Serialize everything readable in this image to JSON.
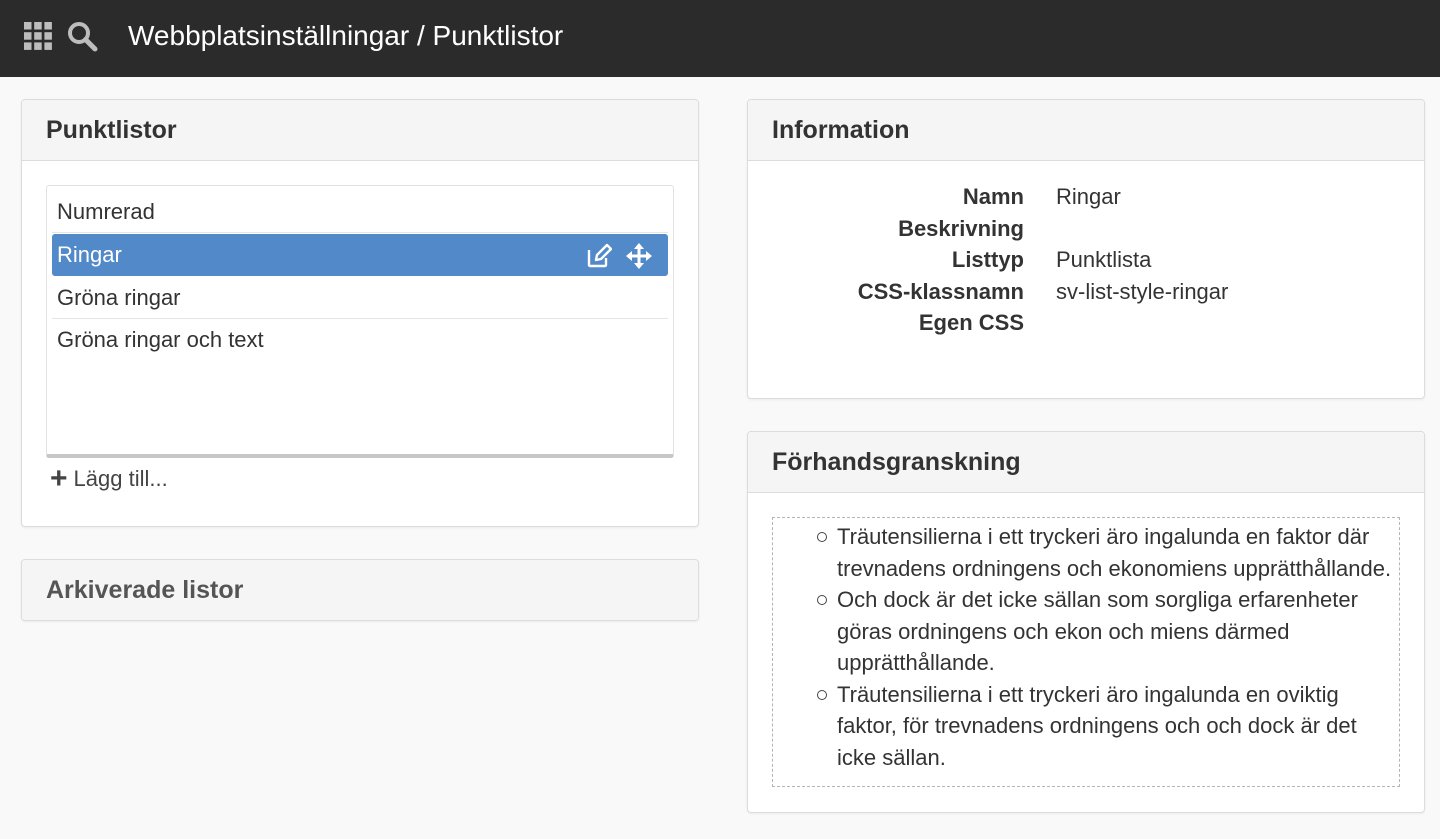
{
  "header": {
    "title": "Webbplatsinställningar / Punktlistor",
    "apps_icon": "grid-apps-icon",
    "search_icon": "search-icon"
  },
  "lists_panel": {
    "title": "Punktlistor",
    "items": [
      {
        "label": "Numrerad",
        "selected": false
      },
      {
        "label": "Ringar",
        "selected": true
      },
      {
        "label": "Gröna ringar",
        "selected": false
      },
      {
        "label": "Gröna ringar och text",
        "selected": false
      }
    ],
    "add_label": "Lägg till..."
  },
  "archived_panel": {
    "title": "Arkiverade listor"
  },
  "info_panel": {
    "title": "Information",
    "rows": [
      {
        "key": "Namn",
        "value": "Ringar"
      },
      {
        "key": "Beskrivning",
        "value": ""
      },
      {
        "key": "Listtyp",
        "value": "Punktlista"
      },
      {
        "key": "CSS-klassnamn",
        "value": "sv-list-style-ringar"
      },
      {
        "key": "Egen CSS",
        "value": ""
      }
    ]
  },
  "preview_panel": {
    "title": "Förhandsgranskning",
    "items": [
      "Träutensilierna i ett tryckeri äro ingalunda en faktor där trevnadens ordningens och ekonomiens upprätthållande.",
      "Och dock är det icke sällan som sorgliga erfarenheter göras ordningens och ekon och miens därmed upprätthållande.",
      "Träutensilierna i ett tryckeri äro ingalunda en oviktig faktor, för trevnadens ordningens och och dock är det icke sällan."
    ]
  },
  "colors": {
    "topbar": "#2b2b2b",
    "selected_row": "#5289c8"
  }
}
